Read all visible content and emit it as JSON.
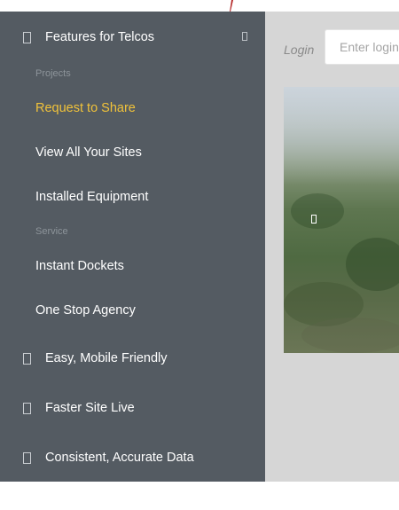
{
  "colors": {
    "sidebar_bg": "#545b62",
    "main_bg": "#d6d6d6",
    "active_item": "#f0c23a",
    "group_label": "#8d949a",
    "logo_accent": "#b52a2a"
  },
  "sidebar": {
    "sections": [
      {
        "label": "Features for Telcos",
        "icon": "box-icon",
        "expanded": true,
        "toggle_icon": "collapse-icon"
      },
      {
        "label": "Easy, Mobile Friendly",
        "icon": "box-icon"
      },
      {
        "label": "Faster Site Live",
        "icon": "box-icon"
      },
      {
        "label": "Consistent, Accurate Data",
        "icon": "box-icon"
      }
    ],
    "groups": [
      {
        "label": "Projects",
        "items": [
          {
            "label": "Request to Share",
            "active": true
          },
          {
            "label": "View All Your Sites"
          },
          {
            "label": "Installed Equipment"
          }
        ]
      },
      {
        "label": "Service",
        "items": [
          {
            "label": "Instant Dockets"
          },
          {
            "label": "One Stop Agency"
          }
        ]
      }
    ]
  },
  "main": {
    "login": {
      "label": "Login",
      "placeholder": "Enter login"
    },
    "slideshow": {
      "icon": "slide-icon"
    }
  }
}
